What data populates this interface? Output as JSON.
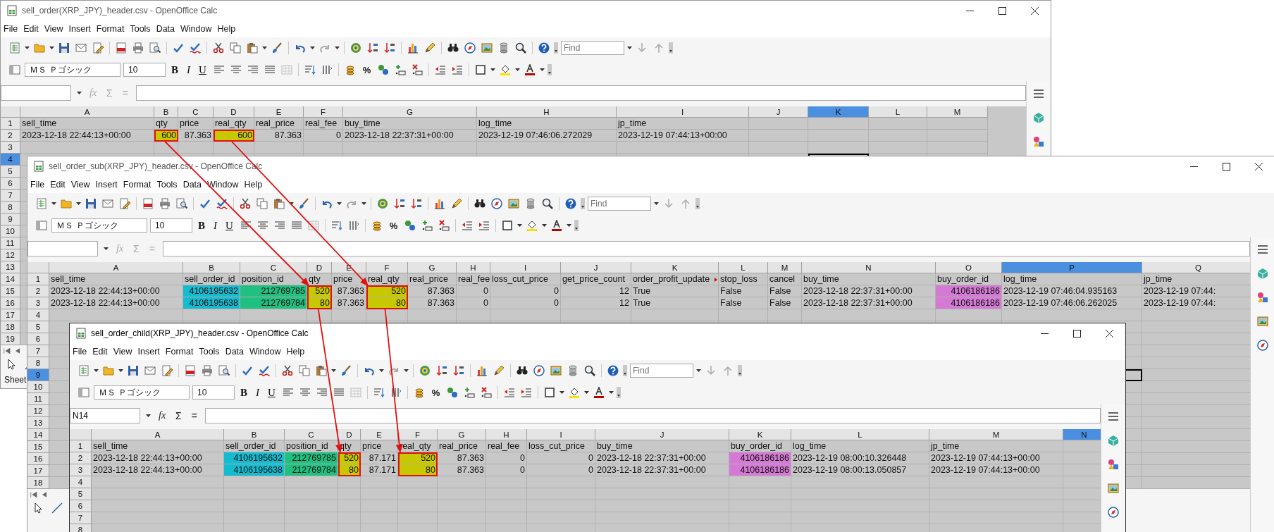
{
  "windows": [
    {
      "title": "sell_order(XRP_JPY)_header.csv - OpenOffice Calc",
      "active": false,
      "menu": [
        "File",
        "Edit",
        "View",
        "Insert",
        "Format",
        "Tools",
        "Data",
        "Window",
        "Help"
      ],
      "find": {
        "placeholder": "Find"
      },
      "font_name": "ＭＳ Ｐゴシック",
      "font_size": "10",
      "format_buttons": [
        "B",
        "I",
        "U"
      ],
      "percent": "%",
      "formula_symbols": [
        "fx",
        "Σ",
        "="
      ],
      "formula_enabled": false,
      "columns": [
        {
          "letter": "A",
          "selected": false
        },
        {
          "letter": "B",
          "selected": false
        },
        {
          "letter": "C",
          "selected": false
        },
        {
          "letter": "D",
          "selected": false
        },
        {
          "letter": "E",
          "selected": false
        },
        {
          "letter": "F",
          "selected": false
        },
        {
          "letter": "G",
          "selected": false
        },
        {
          "letter": "H",
          "selected": false
        },
        {
          "letter": "I",
          "selected": false
        },
        {
          "letter": "J",
          "selected": false
        },
        {
          "letter": "K",
          "selected": true
        },
        {
          "letter": "L",
          "selected": false
        },
        {
          "letter": "M",
          "selected": false
        }
      ],
      "rows": [
        {
          "number": "1",
          "selected": false,
          "cells": [
            "sell_time",
            "qty",
            "price",
            "real_qty",
            "real_price",
            "real_fee",
            "buy_time",
            "log_time",
            "jp_time"
          ]
        },
        {
          "number": "2",
          "selected": false,
          "cells": [
            "2023-12-18 22:44:13+00:00",
            {
              "text": "600",
              "kind": "number",
              "color": "#c8c800",
              "marked": true
            },
            {
              "text": "87.363",
              "kind": "number"
            },
            {
              "text": "600",
              "kind": "number",
              "color": "#c8c800",
              "marked": true
            },
            {
              "text": "87.363",
              "kind": "number"
            },
            {
              "text": "0",
              "kind": "number"
            },
            "2023-12-18 22:37:31+00:00",
            "2023-12-19 07:46:06.272029",
            "2023-12-19 07:44:13+00:00"
          ]
        },
        {
          "number": "3",
          "selected": false,
          "cells": []
        },
        {
          "number": "4",
          "selected": true,
          "cells": []
        },
        {
          "number": "5",
          "selected": false,
          "cells": []
        },
        {
          "number": "6",
          "selected": false,
          "cells": []
        },
        {
          "number": "7",
          "selected": false,
          "cells": []
        },
        {
          "number": "8",
          "selected": false,
          "cells": []
        },
        {
          "number": "9",
          "selected": false,
          "cells": []
        },
        {
          "number": "10",
          "selected": false,
          "cells": []
        },
        {
          "number": "11",
          "selected": false,
          "cells": []
        },
        {
          "number": "12",
          "selected": false,
          "cells": []
        },
        {
          "number": "13",
          "selected": false,
          "cells": []
        },
        {
          "number": "14",
          "selected": false,
          "cells": []
        },
        {
          "number": "15",
          "selected": false,
          "cells": []
        },
        {
          "number": "16",
          "selected": false,
          "cells": []
        },
        {
          "number": "17",
          "selected": false,
          "cells": []
        },
        {
          "number": "18",
          "selected": false,
          "cells": []
        },
        {
          "number": "19",
          "selected": false,
          "cells": []
        }
      ],
      "status": "Sheet"
    },
    {
      "title": "sell_order_sub(XRP_JPY)_header.csv - OpenOffice Calc",
      "active": false,
      "menu": [
        "File",
        "Edit",
        "View",
        "Insert",
        "Format",
        "Tools",
        "Data",
        "Window",
        "Help"
      ],
      "find": {
        "placeholder": "Find"
      },
      "font_name": "ＭＳ Ｐゴシック",
      "font_size": "10",
      "format_buttons": [
        "B",
        "I",
        "U"
      ],
      "percent": "%",
      "formula_symbols": [
        "fx",
        "Σ",
        "="
      ],
      "formula_enabled": false,
      "columns": [
        {
          "letter": "A",
          "selected": false
        },
        {
          "letter": "B",
          "selected": false
        },
        {
          "letter": "C",
          "selected": false
        },
        {
          "letter": "D",
          "selected": false
        },
        {
          "letter": "E",
          "selected": false
        },
        {
          "letter": "F",
          "selected": false
        },
        {
          "letter": "G",
          "selected": false
        },
        {
          "letter": "H",
          "selected": false
        },
        {
          "letter": "I",
          "selected": false
        },
        {
          "letter": "J",
          "selected": false
        },
        {
          "letter": "K",
          "selected": false
        },
        {
          "letter": "L",
          "selected": false
        },
        {
          "letter": "M",
          "selected": false
        },
        {
          "letter": "N",
          "selected": false
        },
        {
          "letter": "O",
          "selected": false
        },
        {
          "letter": "P",
          "selected": true
        },
        {
          "letter": "Q",
          "selected": false
        }
      ],
      "rows": [
        {
          "number": "1",
          "selected": false,
          "cells": [
            "sell_time",
            "sell_order_id",
            "position_id",
            "qty",
            "price",
            "real_qty",
            "real_price",
            "real_fee",
            "loss_cut_price",
            "get_price_count",
            {
              "text": "order_profit_update",
              "kind": "text",
              "overflow": true
            },
            "stop_loss",
            "cancel",
            "buy_time",
            "buy_order_id",
            "log_time",
            "jp_time"
          ]
        },
        {
          "number": "2",
          "selected": false,
          "cells": [
            "2023-12-18 22:44:13+00:00",
            {
              "text": "4106195632",
              "kind": "number",
              "color": "#13bcd0"
            },
            {
              "text": "212769785",
              "kind": "number",
              "color": "#20c080"
            },
            {
              "text": "520",
              "kind": "number",
              "color": "#c8c800",
              "marked": true
            },
            {
              "text": "87.363",
              "kind": "number"
            },
            {
              "text": "520",
              "kind": "number",
              "color": "#c8c800",
              "marked": true
            },
            {
              "text": "87.363",
              "kind": "number"
            },
            {
              "text": "0",
              "kind": "number"
            },
            {
              "text": "0",
              "kind": "number"
            },
            {
              "text": "12",
              "kind": "number"
            },
            "True",
            "False",
            "False",
            "2023-12-18 22:37:31+00:00",
            {
              "text": "4106186186",
              "kind": "number",
              "color": "#d47ad4"
            },
            "2023-12-19 07:46:04.935163",
            "2023-12-19 07:44:"
          ]
        },
        {
          "number": "3",
          "selected": false,
          "cells": [
            "2023-12-18 22:44:13+00:00",
            {
              "text": "4106195638",
              "kind": "number",
              "color": "#13bcd0"
            },
            {
              "text": "212769784",
              "kind": "number",
              "color": "#20c080"
            },
            {
              "text": "80",
              "kind": "number",
              "color": "#c8c800",
              "marked": true
            },
            {
              "text": "87.363",
              "kind": "number"
            },
            {
              "text": "80",
              "kind": "number",
              "color": "#c8c800",
              "marked": true
            },
            {
              "text": "87.363",
              "kind": "number"
            },
            {
              "text": "0",
              "kind": "number"
            },
            {
              "text": "0",
              "kind": "number"
            },
            {
              "text": "12",
              "kind": "number"
            },
            "True",
            "False",
            "False",
            "2023-12-18 22:37:31+00:00",
            {
              "text": "4106186186",
              "kind": "number",
              "color": "#d47ad4"
            },
            "2023-12-19 07:46:06.262025",
            "2023-12-19 07:44:"
          ]
        },
        {
          "number": "4",
          "selected": false,
          "cells": []
        },
        {
          "number": "5",
          "selected": false,
          "cells": []
        },
        {
          "number": "6",
          "selected": false,
          "cells": []
        },
        {
          "number": "7",
          "selected": false,
          "cells": []
        },
        {
          "number": "8",
          "selected": false,
          "cells": []
        },
        {
          "number": "9",
          "selected": true,
          "cells": []
        },
        {
          "number": "10",
          "selected": false,
          "cells": []
        },
        {
          "number": "11",
          "selected": false,
          "cells": []
        },
        {
          "number": "12",
          "selected": false,
          "cells": []
        },
        {
          "number": "13",
          "selected": false,
          "cells": []
        },
        {
          "number": "14",
          "selected": false,
          "cells": []
        },
        {
          "number": "15",
          "selected": false,
          "cells": []
        },
        {
          "number": "16",
          "selected": false,
          "cells": []
        },
        {
          "number": "17",
          "selected": false,
          "cells": []
        },
        {
          "number": "18",
          "selected": false,
          "cells": []
        }
      ]
    },
    {
      "title": "sell_order_child(XRP_JPY)_header.csv - OpenOffice Calc",
      "active": true,
      "menu": [
        "File",
        "Edit",
        "View",
        "Insert",
        "Format",
        "Tools",
        "Data",
        "Window",
        "Help"
      ],
      "find": {
        "placeholder": "Find"
      },
      "font_name": "ＭＳ Ｐゴシック",
      "font_size": "10",
      "format_buttons": [
        "B",
        "I",
        "U"
      ],
      "percent": "%",
      "name_box": "N14",
      "formula_symbols": [
        "fx",
        "Σ",
        "="
      ],
      "formula_enabled": true,
      "columns": [
        {
          "letter": "A",
          "selected": false
        },
        {
          "letter": "B",
          "selected": false
        },
        {
          "letter": "C",
          "selected": false
        },
        {
          "letter": "D",
          "selected": false
        },
        {
          "letter": "E",
          "selected": false
        },
        {
          "letter": "F",
          "selected": false
        },
        {
          "letter": "G",
          "selected": false
        },
        {
          "letter": "H",
          "selected": false
        },
        {
          "letter": "I",
          "selected": false
        },
        {
          "letter": "J",
          "selected": false
        },
        {
          "letter": "K",
          "selected": false
        },
        {
          "letter": "L",
          "selected": false
        },
        {
          "letter": "M",
          "selected": false
        },
        {
          "letter": "N",
          "selected": true
        }
      ],
      "rows": [
        {
          "number": "1",
          "selected": false,
          "cells": [
            "sell_time",
            "sell_order_id",
            "position_id",
            "qty",
            "price",
            "real_qty",
            "real_price",
            "real_fee",
            "loss_cut_price",
            "buy_time",
            "buy_order_id",
            "log_time",
            "jp_time"
          ]
        },
        {
          "number": "2",
          "selected": false,
          "cells": [
            "2023-12-18 22:44:13+00:00",
            {
              "text": "4106195632",
              "kind": "number",
              "color": "#13bcd0"
            },
            {
              "text": "212769785",
              "kind": "number",
              "color": "#20c080"
            },
            {
              "text": "520",
              "kind": "number",
              "color": "#c8c800",
              "marked": true
            },
            {
              "text": "87.171",
              "kind": "number"
            },
            {
              "text": "520",
              "kind": "number",
              "color": "#c8c800",
              "marked": true
            },
            {
              "text": "87.363",
              "kind": "number"
            },
            {
              "text": "0",
              "kind": "number"
            },
            {
              "text": "0",
              "kind": "number"
            },
            "2023-12-18 22:37:31+00:00",
            {
              "text": "4106186186",
              "kind": "number",
              "color": "#d47ad4"
            },
            "2023-12-19 08:00:10.326448",
            "2023-12-19 07:44:13+00:00"
          ]
        },
        {
          "number": "3",
          "selected": false,
          "cells": [
            "2023-12-18 22:44:13+00:00",
            {
              "text": "4106195638",
              "kind": "number",
              "color": "#13bcd0"
            },
            {
              "text": "212769784",
              "kind": "number",
              "color": "#20c080"
            },
            {
              "text": "80",
              "kind": "number",
              "color": "#c8c800",
              "marked": true
            },
            {
              "text": "87.171",
              "kind": "number"
            },
            {
              "text": "80",
              "kind": "number",
              "color": "#c8c800",
              "marked": true
            },
            {
              "text": "87.363",
              "kind": "number"
            },
            {
              "text": "0",
              "kind": "number"
            },
            {
              "text": "0",
              "kind": "number"
            },
            "2023-12-18 22:37:31+00:00",
            {
              "text": "4106186186",
              "kind": "number",
              "color": "#d47ad4"
            },
            "2023-12-19 08:00:13.050857",
            "2023-12-19 07:44:13+00:00"
          ]
        },
        {
          "number": "4",
          "selected": false,
          "cells": []
        },
        {
          "number": "5",
          "selected": false,
          "cells": []
        },
        {
          "number": "6",
          "selected": false,
          "cells": []
        },
        {
          "number": "7",
          "selected": false,
          "cells": []
        },
        {
          "number": "8",
          "selected": false,
          "cells": []
        }
      ]
    }
  ]
}
